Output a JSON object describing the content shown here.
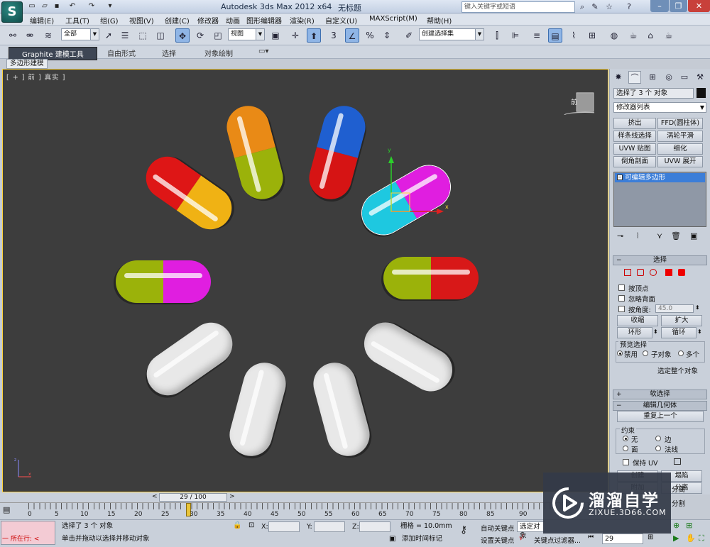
{
  "titlebar": {
    "title": "Autodesk 3ds Max  2012 x64",
    "document": "无标题",
    "search_placeholder": "键入关键字或短语"
  },
  "menubar": {
    "items": [
      "编辑(E)",
      "工具(T)",
      "组(G)",
      "视图(V)",
      "创建(C)",
      "修改器",
      "动画",
      "图形编辑器",
      "渲染(R)",
      "自定义(U)",
      "MAXScript(M)",
      "帮助(H)"
    ]
  },
  "toolbar": {
    "selection_filter": "全部",
    "coord_system": "视图",
    "named_selection": "创建选择集",
    "snap_label": "3"
  },
  "ribbon": {
    "tabs": [
      "Graphite 建模工具",
      "自由形式",
      "选择",
      "对象绘制"
    ],
    "subtab": "多边形建模"
  },
  "viewport": {
    "label": "[ + ] 前 ] 真实 ]",
    "viewcube_label": "前"
  },
  "cmdpanel": {
    "object_name": "选择了 3 个 对象",
    "modifier_list": "修改器列表",
    "modifier_buttons": [
      "挤出",
      "FFD(圆柱体)",
      "样条线选择",
      "涡轮平滑",
      "UVW 贴图",
      "细化",
      "倒角剖面",
      "UVW 展开"
    ],
    "stack_item": "可编辑多边形",
    "selection_rollout": "选择",
    "by_vertex": "按顶点",
    "ignore_backfacing": "忽略背面",
    "by_angle": "按角度:",
    "angle_value": "45.0",
    "shrink": "收缩",
    "grow": "扩大",
    "ring": "环形",
    "loop": "循环",
    "preview_selection": "预览选择",
    "preview_options": [
      "禁用",
      "子对象",
      "多个"
    ],
    "whole_object": "选定整个对象",
    "soft_selection": "软选择",
    "edit_geometry": "编辑几何体",
    "repeat_last": "重复上一个",
    "constraints": "约束",
    "constraint_options": [
      "无",
      "边",
      "面",
      "法线"
    ],
    "preserve_uv": "保持 UV",
    "create": "创建",
    "collapse": "塌陷",
    "attach": "附加",
    "detach": "分离",
    "slice_plane": "切片平面",
    "split": "分割"
  },
  "timeline": {
    "frame_label": "29 / 100",
    "ticks": [
      "0",
      "5",
      "10",
      "15",
      "20",
      "25",
      "30",
      "35",
      "40",
      "45",
      "50",
      "55",
      "60",
      "65",
      "70",
      "75",
      "80",
      "85",
      "90"
    ],
    "current_frame": 29
  },
  "status": {
    "script_listener": "所在行:",
    "selection_info": "选择了 3 个 对象",
    "prompt": "单击并拖动以选择并移动对象",
    "x_label": "X:",
    "y_label": "Y:",
    "z_label": "Z:",
    "grid": "栅格 = 10.0mm",
    "add_time_tag": "添加时间标记",
    "auto_key": "自动关键点",
    "set_key": "设置关键点",
    "selected_object": "选定对象",
    "key_filters": "关键点过滤器...",
    "frame_value": "29"
  },
  "watermark": {
    "brand": "溜溜自学",
    "url": "ZIXUE.3D66.COM"
  }
}
